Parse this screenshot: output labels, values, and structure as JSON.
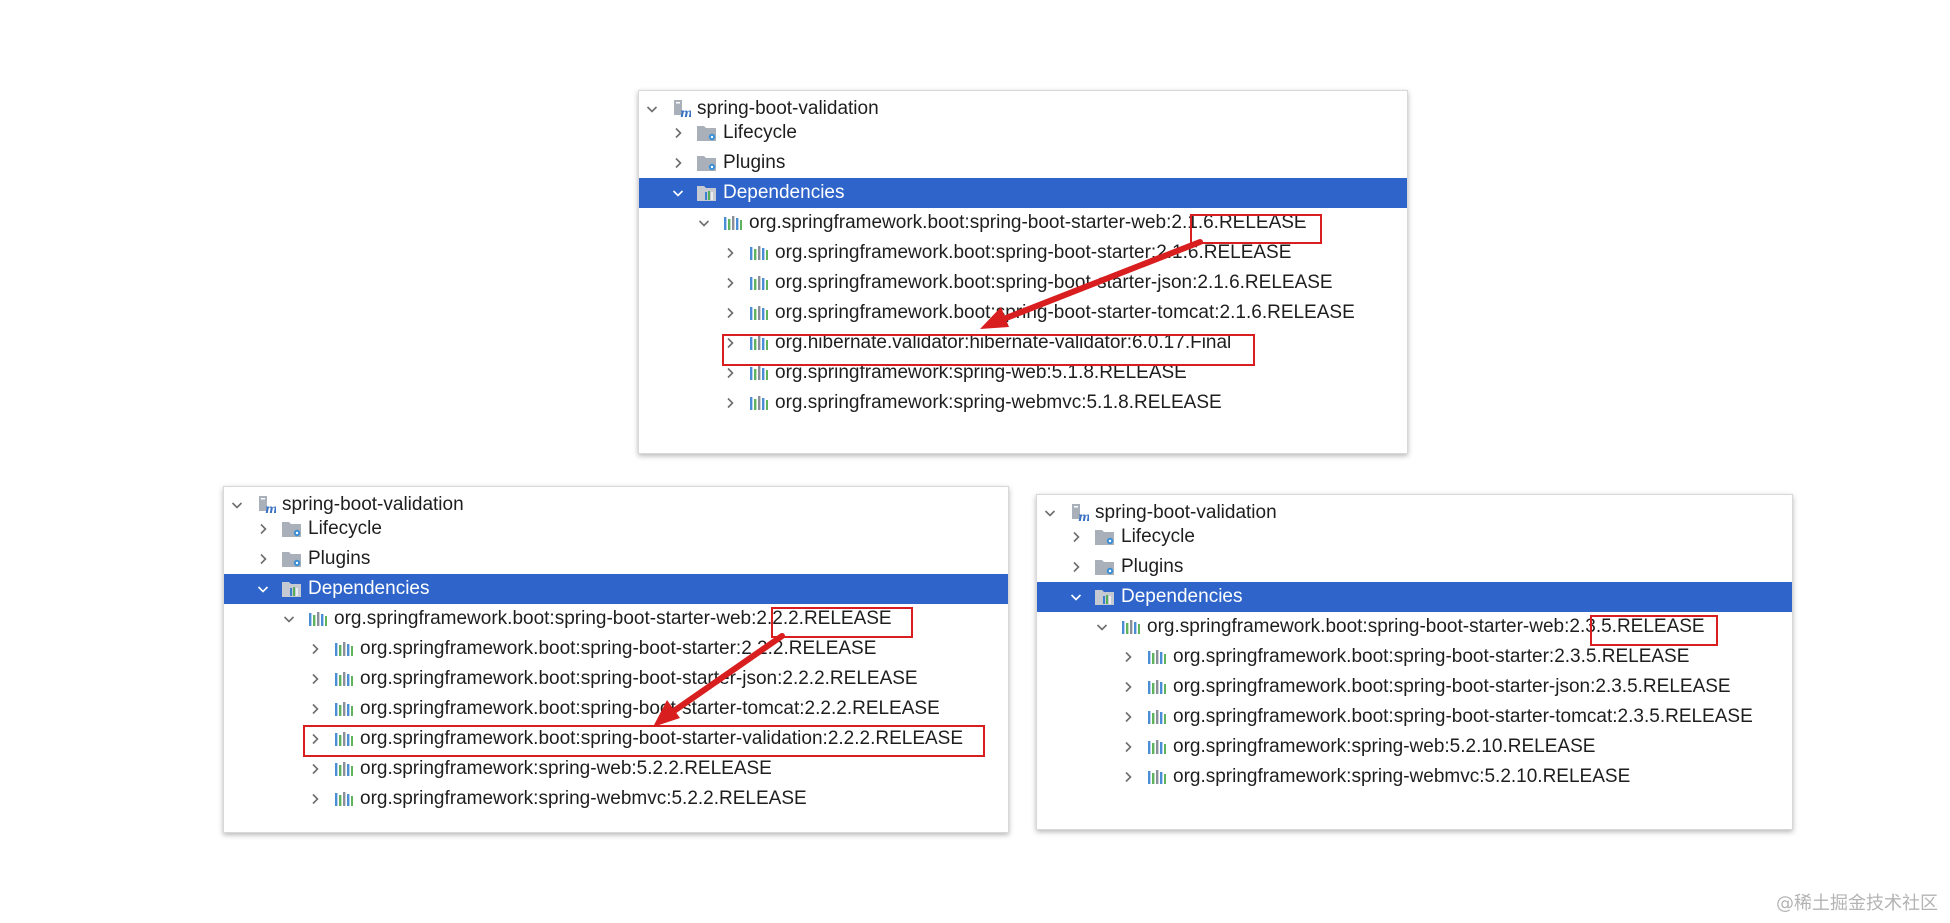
{
  "panels": [
    {
      "project": "spring-boot-validation",
      "lifecycle": "Lifecycle",
      "plugins": "Plugins",
      "dependencies": "Dependencies",
      "starter_web_prefix": "org.springframework.boot:spring-boot-starter-web:",
      "starter_web_version": "2.1.6.RELEASE",
      "children": [
        "org.springframework.boot:spring-boot-starter:2.1.6.RELEASE",
        "org.springframework.boot:spring-boot-starter-json:2.1.6.RELEASE",
        "org.springframework.boot:spring-boot-starter-tomcat:2.1.6.RELEASE",
        "org.hibernate.validator:hibernate-validator:6.0.17.Final",
        "org.springframework:spring-web:5.1.8.RELEASE",
        "org.springframework:spring-webmvc:5.1.8.RELEASE"
      ]
    },
    {
      "project": "spring-boot-validation",
      "lifecycle": "Lifecycle",
      "plugins": "Plugins",
      "dependencies": "Dependencies",
      "starter_web_prefix": "org.springframework.boot:spring-boot-starter-web:",
      "starter_web_version": "2.2.2.RELEASE",
      "children": [
        "org.springframework.boot:spring-boot-starter:2.2.2.RELEASE",
        "org.springframework.boot:spring-boot-starter-json:2.2.2.RELEASE",
        "org.springframework.boot:spring-boot-starter-tomcat:2.2.2.RELEASE",
        "org.springframework.boot:spring-boot-starter-validation:2.2.2.RELEASE",
        "org.springframework:spring-web:5.2.2.RELEASE",
        "org.springframework:spring-webmvc:5.2.2.RELEASE"
      ]
    },
    {
      "project": "spring-boot-validation",
      "lifecycle": "Lifecycle",
      "plugins": "Plugins",
      "dependencies": "Dependencies",
      "starter_web_prefix": "org.springframework.boot:spring-boot-starter-web:",
      "starter_web_version": "2.3.5.RELEASE",
      "children": [
        "org.springframework.boot:spring-boot-starter:2.3.5.RELEASE",
        "org.springframework.boot:spring-boot-starter-json:2.3.5.RELEASE",
        "org.springframework.boot:spring-boot-starter-tomcat:2.3.5.RELEASE",
        "org.springframework:spring-web:5.2.10.RELEASE",
        "org.springframework:spring-webmvc:5.2.10.RELEASE"
      ]
    }
  ],
  "icons": {
    "project": "maven-project-icon",
    "folder": "folder-gear-icon",
    "dependencies": "dependencies-folder-icon",
    "library": "library-icon",
    "expanded": "chevron-down-icon",
    "collapsed": "chevron-right-icon"
  },
  "colors": {
    "selection": "#2f65ca",
    "highlight": "#d81e1e",
    "library_blue": "#4b8ed6",
    "library_green": "#5fb35c",
    "library_gray": "#8a9099"
  },
  "watermark": "@稀土掘金技术社区"
}
